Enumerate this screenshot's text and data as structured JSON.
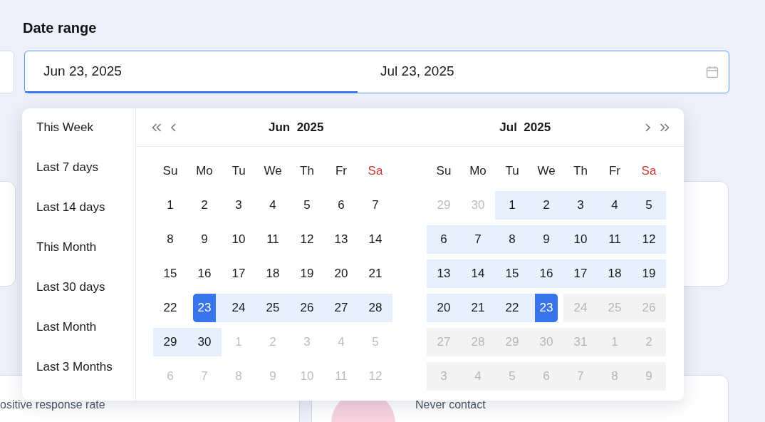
{
  "title": "Date range",
  "range_input": {
    "start": {
      "value": "Jun 23, 2025",
      "active": true
    },
    "end": {
      "value": "Jul 23, 2025",
      "active": false
    }
  },
  "cards": {
    "left_label": "ositive response rate",
    "right_label": "Never contact"
  },
  "picker": {
    "presets": [
      {
        "label": "This Week"
      },
      {
        "label": "Last 7 days"
      },
      {
        "label": "Last 14 days"
      },
      {
        "label": "This Month"
      },
      {
        "label": "Last 30 days"
      },
      {
        "label": "Last Month"
      },
      {
        "label": "Last 3 Months"
      }
    ],
    "months": [
      {
        "month": "Jun",
        "year": "2025",
        "weekdays": [
          {
            "label": "Su",
            "color": "#1f1f1f"
          },
          {
            "label": "Mo",
            "color": "#1f1f1f"
          },
          {
            "label": "Tu",
            "color": "#1f1f1f"
          },
          {
            "label": "We",
            "color": "#1f1f1f"
          },
          {
            "label": "Th",
            "color": "#1f1f1f"
          },
          {
            "label": "Fr",
            "color": "#1f1f1f"
          },
          {
            "label": "Sa",
            "color": "#c8372d"
          }
        ],
        "weeks": [
          [
            {
              "d": "1",
              "kind": "current",
              "in_range": false,
              "selected": false
            },
            {
              "d": "2",
              "kind": "current",
              "in_range": false,
              "selected": false
            },
            {
              "d": "3",
              "kind": "current",
              "in_range": false,
              "selected": false
            },
            {
              "d": "4",
              "kind": "current",
              "in_range": false,
              "selected": false
            },
            {
              "d": "5",
              "kind": "current",
              "in_range": false,
              "selected": false
            },
            {
              "d": "6",
              "kind": "current",
              "in_range": false,
              "selected": false
            },
            {
              "d": "7",
              "kind": "current",
              "in_range": false,
              "selected": false
            }
          ],
          [
            {
              "d": "8",
              "kind": "current",
              "in_range": false,
              "selected": false
            },
            {
              "d": "9",
              "kind": "current",
              "in_range": false,
              "selected": false
            },
            {
              "d": "10",
              "kind": "current",
              "in_range": false,
              "selected": false
            },
            {
              "d": "11",
              "kind": "current",
              "in_range": false,
              "selected": false
            },
            {
              "d": "12",
              "kind": "current",
              "in_range": false,
              "selected": false
            },
            {
              "d": "13",
              "kind": "current",
              "in_range": false,
              "selected": false
            },
            {
              "d": "14",
              "kind": "current",
              "in_range": false,
              "selected": false
            }
          ],
          [
            {
              "d": "15",
              "kind": "current",
              "in_range": false,
              "selected": false
            },
            {
              "d": "16",
              "kind": "current",
              "in_range": false,
              "selected": false
            },
            {
              "d": "17",
              "kind": "current",
              "in_range": false,
              "selected": false
            },
            {
              "d": "18",
              "kind": "current",
              "in_range": false,
              "selected": false
            },
            {
              "d": "19",
              "kind": "current",
              "in_range": false,
              "selected": false
            },
            {
              "d": "20",
              "kind": "current",
              "in_range": false,
              "selected": false
            },
            {
              "d": "21",
              "kind": "current",
              "in_range": false,
              "selected": false
            }
          ],
          [
            {
              "d": "22",
              "kind": "current",
              "in_range": false,
              "selected": false
            },
            {
              "d": "23",
              "kind": "current",
              "in_range": true,
              "selected": true
            },
            {
              "d": "24",
              "kind": "current",
              "in_range": true,
              "selected": false
            },
            {
              "d": "25",
              "kind": "current",
              "in_range": true,
              "selected": false
            },
            {
              "d": "26",
              "kind": "current",
              "in_range": true,
              "selected": false
            },
            {
              "d": "27",
              "kind": "current",
              "in_range": true,
              "selected": false
            },
            {
              "d": "28",
              "kind": "current",
              "in_range": true,
              "selected": false
            }
          ],
          [
            {
              "d": "29",
              "kind": "current",
              "in_range": true,
              "selected": false
            },
            {
              "d": "30",
              "kind": "current",
              "in_range": true,
              "selected": false
            },
            {
              "d": "1",
              "kind": "adjacent",
              "in_range": false,
              "selected": false
            },
            {
              "d": "2",
              "kind": "adjacent",
              "in_range": false,
              "selected": false
            },
            {
              "d": "3",
              "kind": "adjacent",
              "in_range": false,
              "selected": false
            },
            {
              "d": "4",
              "kind": "adjacent",
              "in_range": false,
              "selected": false
            },
            {
              "d": "5",
              "kind": "adjacent",
              "in_range": false,
              "selected": false
            }
          ],
          [
            {
              "d": "6",
              "kind": "adjacent",
              "in_range": false,
              "selected": false
            },
            {
              "d": "7",
              "kind": "adjacent",
              "in_range": false,
              "selected": false
            },
            {
              "d": "8",
              "kind": "adjacent",
              "in_range": false,
              "selected": false
            },
            {
              "d": "9",
              "kind": "adjacent",
              "in_range": false,
              "selected": false
            },
            {
              "d": "10",
              "kind": "adjacent",
              "in_range": false,
              "selected": false
            },
            {
              "d": "11",
              "kind": "adjacent",
              "in_range": false,
              "selected": false
            },
            {
              "d": "12",
              "kind": "adjacent",
              "in_range": false,
              "selected": false
            }
          ]
        ]
      },
      {
        "month": "Jul",
        "year": "2025",
        "weekdays": [
          {
            "label": "Su",
            "color": "#1f1f1f"
          },
          {
            "label": "Mo",
            "color": "#1f1f1f"
          },
          {
            "label": "Tu",
            "color": "#1f1f1f"
          },
          {
            "label": "We",
            "color": "#1f1f1f"
          },
          {
            "label": "Th",
            "color": "#1f1f1f"
          },
          {
            "label": "Fr",
            "color": "#1f1f1f"
          },
          {
            "label": "Sa",
            "color": "#c8372d"
          }
        ],
        "weeks": [
          [
            {
              "d": "29",
              "kind": "adjacent",
              "in_range": false,
              "selected": false
            },
            {
              "d": "30",
              "kind": "adjacent",
              "in_range": false,
              "selected": false
            },
            {
              "d": "1",
              "kind": "current",
              "in_range": true,
              "selected": false
            },
            {
              "d": "2",
              "kind": "current",
              "in_range": true,
              "selected": false
            },
            {
              "d": "3",
              "kind": "current",
              "in_range": true,
              "selected": false
            },
            {
              "d": "4",
              "kind": "current",
              "in_range": true,
              "selected": false
            },
            {
              "d": "5",
              "kind": "current",
              "in_range": true,
              "selected": false
            }
          ],
          [
            {
              "d": "6",
              "kind": "current",
              "in_range": true,
              "selected": false
            },
            {
              "d": "7",
              "kind": "current",
              "in_range": true,
              "selected": false
            },
            {
              "d": "8",
              "kind": "current",
              "in_range": true,
              "selected": false
            },
            {
              "d": "9",
              "kind": "current",
              "in_range": true,
              "selected": false
            },
            {
              "d": "10",
              "kind": "current",
              "in_range": true,
              "selected": false
            },
            {
              "d": "11",
              "kind": "current",
              "in_range": true,
              "selected": false
            },
            {
              "d": "12",
              "kind": "current",
              "in_range": true,
              "selected": false
            }
          ],
          [
            {
              "d": "13",
              "kind": "current",
              "in_range": true,
              "selected": false
            },
            {
              "d": "14",
              "kind": "current",
              "in_range": true,
              "selected": false
            },
            {
              "d": "15",
              "kind": "current",
              "in_range": true,
              "selected": false
            },
            {
              "d": "16",
              "kind": "current",
              "in_range": true,
              "selected": false
            },
            {
              "d": "17",
              "kind": "current",
              "in_range": true,
              "selected": false
            },
            {
              "d": "18",
              "kind": "current",
              "in_range": true,
              "selected": false
            },
            {
              "d": "19",
              "kind": "current",
              "in_range": true,
              "selected": false
            }
          ],
          [
            {
              "d": "20",
              "kind": "current",
              "in_range": true,
              "selected": false
            },
            {
              "d": "21",
              "kind": "current",
              "in_range": true,
              "selected": false
            },
            {
              "d": "22",
              "kind": "current",
              "in_range": true,
              "selected": false
            },
            {
              "d": "23",
              "kind": "current",
              "in_range": true,
              "selected": true
            },
            {
              "d": "24",
              "kind": "disabled",
              "in_range": false,
              "selected": false
            },
            {
              "d": "25",
              "kind": "disabled",
              "in_range": false,
              "selected": false
            },
            {
              "d": "26",
              "kind": "disabled",
              "in_range": false,
              "selected": false
            }
          ],
          [
            {
              "d": "27",
              "kind": "disabled",
              "in_range": false,
              "selected": false
            },
            {
              "d": "28",
              "kind": "disabled",
              "in_range": false,
              "selected": false
            },
            {
              "d": "29",
              "kind": "disabled",
              "in_range": false,
              "selected": false
            },
            {
              "d": "30",
              "kind": "disabled",
              "in_range": false,
              "selected": false
            },
            {
              "d": "31",
              "kind": "disabled",
              "in_range": false,
              "selected": false
            },
            {
              "d": "1",
              "kind": "disabled",
              "in_range": false,
              "selected": false
            },
            {
              "d": "2",
              "kind": "disabled",
              "in_range": false,
              "selected": false
            }
          ],
          [
            {
              "d": "3",
              "kind": "disabled",
              "in_range": false,
              "selected": false
            },
            {
              "d": "4",
              "kind": "disabled",
              "in_range": false,
              "selected": false
            },
            {
              "d": "5",
              "kind": "disabled",
              "in_range": false,
              "selected": false
            },
            {
              "d": "6",
              "kind": "disabled",
              "in_range": false,
              "selected": false
            },
            {
              "d": "7",
              "kind": "disabled",
              "in_range": false,
              "selected": false
            },
            {
              "d": "8",
              "kind": "disabled",
              "in_range": false,
              "selected": false
            },
            {
              "d": "9",
              "kind": "disabled",
              "in_range": false,
              "selected": false
            }
          ]
        ]
      }
    ]
  }
}
